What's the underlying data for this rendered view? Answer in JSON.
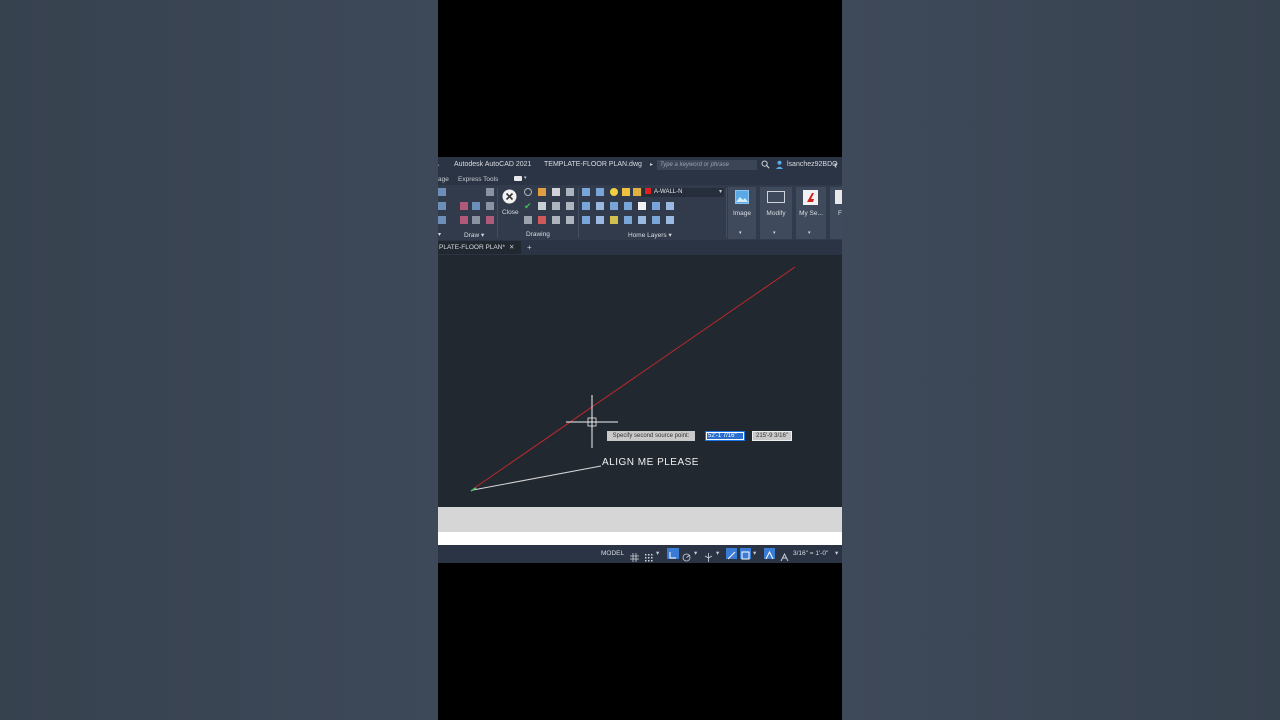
{
  "app": {
    "title": "Autodesk AutoCAD 2021",
    "file_name": "TEMPLATE-FLOOR PLAN.dwg",
    "search_placeholder": "Type a keyword or phrase",
    "user": "lsanchez92BDQ"
  },
  "menubar": {
    "items": [
      "age",
      "Express Tools"
    ]
  },
  "ribbon": {
    "panels": {
      "draw": "Draw",
      "drawing": "Drawing",
      "home_layers": "Home Layers"
    },
    "close_label": "Close",
    "layer_value": "A-WALL-N",
    "buttons": {
      "image": "Image",
      "modify": "Modify",
      "my_se": "My Se...",
      "more": "F"
    }
  },
  "doc_tab": {
    "label": "PLATE-FLOOR PLAN*"
  },
  "canvas": {
    "prompt": "Specify second source point:",
    "input_distance": "52'-1 7/16\"",
    "input_angle": "215'-9 3/16\"",
    "mtext": "ALIGN ME PLEASE"
  },
  "statusbar": {
    "model": "MODEL",
    "scale": "3/16\" = 1'-0\""
  },
  "colors": {
    "red_line": "#c0282c",
    "white_line": "#d8d8d8",
    "canvas_bg": "#212830",
    "ui_dark": "#2b3444"
  }
}
